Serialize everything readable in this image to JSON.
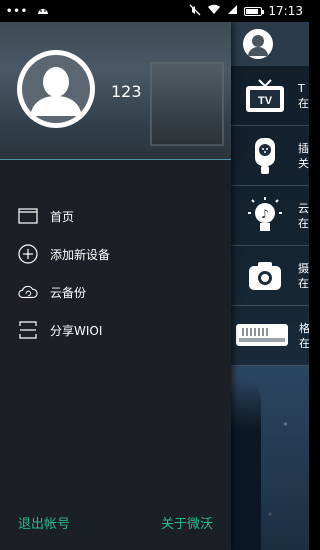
{
  "status": {
    "time": "17:13",
    "dots": "•••"
  },
  "profile": {
    "username": "123"
  },
  "menu": [
    {
      "label": "首页",
      "icon": "home-window-icon"
    },
    {
      "label": "添加新设备",
      "icon": "add-circle-icon"
    },
    {
      "label": "云备份",
      "icon": "cloud-sync-icon"
    },
    {
      "label": "分享WIOI",
      "icon": "share-frame-icon"
    }
  ],
  "footer": {
    "logout": "退出帐号",
    "about": "关于微沃"
  },
  "devices": [
    {
      "line1": "T",
      "line2": "在",
      "icon": "tv-icon"
    },
    {
      "line1": "插",
      "line2": "关",
      "icon": "smart-plug-icon"
    },
    {
      "line1": "云",
      "line2": "在",
      "icon": "music-bulb-icon"
    },
    {
      "line1": "摄",
      "line2": "在",
      "icon": "camera-icon"
    },
    {
      "line1": "格",
      "line2": "在",
      "icon": "air-conditioner-icon"
    }
  ],
  "colors": {
    "accent": "#2bb886",
    "drawer_bg": "#1b2026"
  },
  "battery_level": 0.85
}
